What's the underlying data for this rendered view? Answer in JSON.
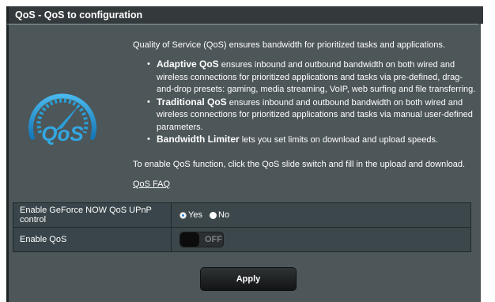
{
  "title": "QoS - QoS to configuration",
  "intro": "Quality of Service (QoS) ensures bandwidth for prioritized tasks and applications.",
  "bullets": [
    {
      "term": "Adaptive QoS",
      "text": " ensures inbound and outbound bandwidth on both wired and wireless connections for prioritized applications and tasks via pre-defined, drag-and-drop presets: gaming, media streaming, VoIP, web surfing and file transferring."
    },
    {
      "term": "Traditional QoS",
      "text": " ensures inbound and outbound bandwidth on both wired and wireless connections for prioritized applications and tasks via manual user-defined parameters."
    },
    {
      "term": "Bandwidth Limiter",
      "text": " lets you set limits on download and upload speeds."
    }
  ],
  "enable_text": "To enable QoS function, click the QoS slide switch and fill in the upload and download.",
  "faq_label": "QoS FAQ",
  "logo_text": "QoS",
  "settings": {
    "geforce": {
      "label": "Enable GeForce NOW QoS UPnP control",
      "yes": "Yes",
      "no": "No",
      "selected": "Yes"
    },
    "enable_qos": {
      "label": "Enable QoS",
      "state": "OFF"
    }
  },
  "apply_label": "Apply",
  "colors": {
    "panel": "#4d5659",
    "titlebar": "#34393b",
    "accent": "#2a9fd6",
    "radio_selected": "#2a7fd4"
  }
}
